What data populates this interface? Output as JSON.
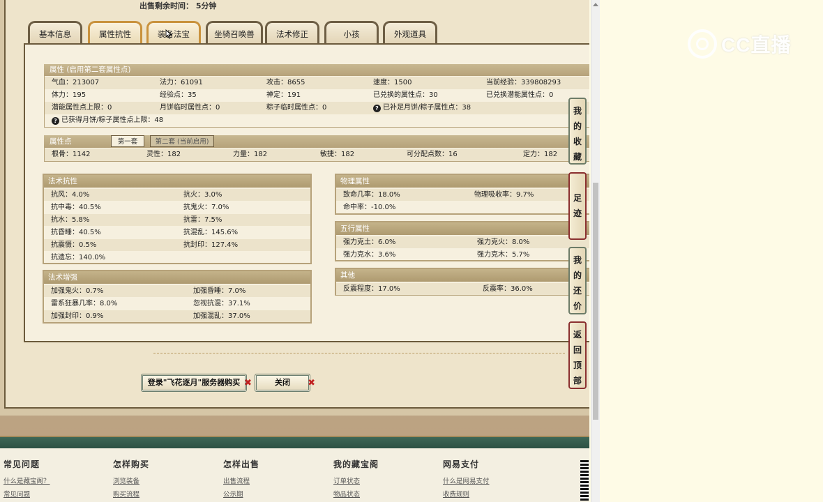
{
  "sale_time": "出售剩余时间：  5分钟",
  "tabs": [
    "基本信息",
    "属性抗性",
    "装备法宝",
    "坐骑召唤兽",
    "法术修正",
    "小孩",
    "外观道具"
  ],
  "attr": {
    "title": "属性 (启用第二套属性点)",
    "rows": [
      [
        "气血：213007",
        "法力：61091",
        "攻击：8655",
        "速度：1500",
        "当前经验：339808293"
      ],
      [
        "体力：195",
        "经验点：35",
        "禅定：191",
        "已兑换的属性点：30",
        "已兑换潜能属性点：0"
      ],
      [
        "潜能属性点上限：0",
        "月饼临时属性点：0",
        "粽子临时属性点：0",
        "已补足月饼/粽子属性点：38"
      ]
    ],
    "extra": "已获得月饼/粽子属性点上限：48"
  },
  "points": {
    "title": "属性点",
    "subtab1": "第一套",
    "subtab2": "第二套 (当前启用)",
    "values": [
      "根骨：1142",
      "灵性：182",
      "力量：182",
      "敏捷：182",
      "可分配点数：16",
      "定力：182"
    ]
  },
  "resist": {
    "title": "法术抗性",
    "rows": [
      [
        "抗风：4.0%",
        "抗火：3.0%"
      ],
      [
        "抗中毒：40.5%",
        "抗鬼火：7.0%"
      ],
      [
        "抗水：5.8%",
        "抗雷：7.5%"
      ],
      [
        "抗昏睡：40.5%",
        "抗混乱：145.6%"
      ],
      [
        "抗震慑：0.5%",
        "抗封印：127.4%"
      ],
      [
        "抗遗忘：140.0%",
        ""
      ]
    ]
  },
  "enhance": {
    "title": "法术增强",
    "rows": [
      [
        "加强鬼火：0.7%",
        "加强昏睡：7.0%"
      ],
      [
        "雷系狂暴几率：8.0%",
        "忽视抗混：37.1%"
      ],
      [
        "加强封印：0.9%",
        "加强混乱：37.0%"
      ]
    ]
  },
  "physical": {
    "title": "物理属性",
    "rows": [
      [
        "致命几率：18.0%",
        "物理吸收率：9.7%"
      ],
      [
        "命中率：-10.0%",
        ""
      ]
    ]
  },
  "elements": {
    "title": "五行属性",
    "rows": [
      [
        "强力克土：6.0%",
        "强力克火：8.0%"
      ],
      [
        "强力克水：3.6%",
        "强力克木：5.7%"
      ]
    ]
  },
  "other": {
    "title": "其他",
    "rows": [
      [
        "反震程度：17.0%",
        "反震率：36.0%"
      ]
    ]
  },
  "buttons": {
    "login_buy": "登录\"飞花逐月\"服务器购买",
    "close": "关闭",
    "x_mark": "✖"
  },
  "side": {
    "favorites": [
      "我",
      "的",
      "收",
      "藏"
    ],
    "footprints": [
      "足",
      "迹"
    ],
    "bargain": [
      "我",
      "的",
      "还",
      "价"
    ],
    "top": [
      "返",
      "回",
      "顶",
      "部"
    ]
  },
  "footer": {
    "cols": [
      {
        "title": "常见问题",
        "links": [
          "什么是藏宝阁？",
          "常见问题"
        ]
      },
      {
        "title": "怎样购买",
        "links": [
          "浏览装备",
          "购买流程"
        ]
      },
      {
        "title": "怎样出售",
        "links": [
          "出售流程",
          "公示期"
        ]
      },
      {
        "title": "我的藏宝阁",
        "links": [
          "订单状态",
          "物品状态"
        ]
      },
      {
        "title": "网易支付",
        "links": [
          "什么是网易支付",
          "收费规则"
        ]
      }
    ]
  },
  "logo_text": "CC直播",
  "colors": {
    "accent": "#c9923d",
    "header": "#b6a27a",
    "footer_band": "#2c5143"
  }
}
